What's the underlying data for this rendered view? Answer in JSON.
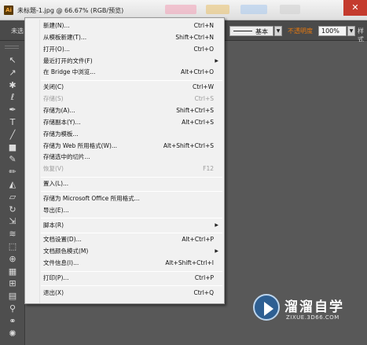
{
  "window": {
    "app_icon_text": "Ai",
    "title": "未标题-1.jpg @ 66.67% (RGB/预览)",
    "close_glyph": "✕"
  },
  "control_bar": {
    "left_label": "未选",
    "stroke_style": "基本",
    "opacity_label": "不透明度",
    "opacity_value": "100%",
    "style_label": "样式"
  },
  "tools": [
    {
      "name": "selection-tool",
      "glyph": "↖"
    },
    {
      "name": "direct-selection-tool",
      "glyph": "↗"
    },
    {
      "name": "magic-wand-tool",
      "glyph": "✱"
    },
    {
      "name": "lasso-tool",
      "glyph": "ℓ"
    },
    {
      "name": "pen-tool",
      "glyph": "✒"
    },
    {
      "name": "type-tool",
      "glyph": "T"
    },
    {
      "name": "line-tool",
      "glyph": "╱"
    },
    {
      "name": "rectangle-tool",
      "glyph": "■"
    },
    {
      "name": "paintbrush-tool",
      "glyph": "✎"
    },
    {
      "name": "pencil-tool",
      "glyph": "✏"
    },
    {
      "name": "blob-brush-tool",
      "glyph": "◭"
    },
    {
      "name": "eraser-tool",
      "glyph": "▱"
    },
    {
      "name": "rotate-tool",
      "glyph": "↻"
    },
    {
      "name": "scale-tool",
      "glyph": "⇲"
    },
    {
      "name": "warp-tool",
      "glyph": "≋"
    },
    {
      "name": "free-transform-tool",
      "glyph": "⬚"
    },
    {
      "name": "shape-builder-tool",
      "glyph": "⊕"
    },
    {
      "name": "perspective-grid-tool",
      "glyph": "▦"
    },
    {
      "name": "mesh-tool",
      "glyph": "⊞"
    },
    {
      "name": "gradient-tool",
      "glyph": "▤"
    },
    {
      "name": "eyedropper-tool",
      "glyph": "⚲"
    },
    {
      "name": "blend-tool",
      "glyph": "⚭"
    },
    {
      "name": "symbol-sprayer-tool",
      "glyph": "✺"
    }
  ],
  "file_menu": {
    "items": [
      {
        "type": "item",
        "label": "新建(N)...",
        "shortcut": "Ctrl+N",
        "enabled": true,
        "submenu": false
      },
      {
        "type": "item",
        "label": "从模板新建(T)...",
        "shortcut": "Shift+Ctrl+N",
        "enabled": true,
        "submenu": false
      },
      {
        "type": "item",
        "label": "打开(O)...",
        "shortcut": "Ctrl+O",
        "enabled": true,
        "submenu": false
      },
      {
        "type": "item",
        "label": "最近打开的文件(F)",
        "shortcut": "",
        "enabled": true,
        "submenu": true
      },
      {
        "type": "item",
        "label": "在 Bridge 中浏览...",
        "shortcut": "Alt+Ctrl+O",
        "enabled": true,
        "submenu": false
      },
      {
        "type": "separator"
      },
      {
        "type": "item",
        "label": "关闭(C)",
        "shortcut": "Ctrl+W",
        "enabled": true,
        "submenu": false
      },
      {
        "type": "item",
        "label": "存储(S)",
        "shortcut": "Ctrl+S",
        "enabled": false,
        "submenu": false
      },
      {
        "type": "item",
        "label": "存储为(A)...",
        "shortcut": "Shift+Ctrl+S",
        "enabled": true,
        "submenu": false
      },
      {
        "type": "item",
        "label": "存储副本(Y)...",
        "shortcut": "Alt+Ctrl+S",
        "enabled": true,
        "submenu": false
      },
      {
        "type": "item",
        "label": "存储为模板...",
        "shortcut": "",
        "enabled": true,
        "submenu": false
      },
      {
        "type": "item",
        "label": "存储为 Web 所用格式(W)...",
        "shortcut": "Alt+Shift+Ctrl+S",
        "enabled": true,
        "submenu": false
      },
      {
        "type": "item",
        "label": "存储选中的切片...",
        "shortcut": "",
        "enabled": true,
        "submenu": false
      },
      {
        "type": "item",
        "label": "恢复(V)",
        "shortcut": "F12",
        "enabled": false,
        "submenu": false
      },
      {
        "type": "separator"
      },
      {
        "type": "item",
        "label": "置入(L)...",
        "shortcut": "",
        "enabled": true,
        "submenu": false
      },
      {
        "type": "separator"
      },
      {
        "type": "item",
        "label": "存储为 Microsoft Office 所用格式...",
        "shortcut": "",
        "enabled": true,
        "submenu": false
      },
      {
        "type": "item",
        "label": "导出(E)...",
        "shortcut": "",
        "enabled": true,
        "submenu": false
      },
      {
        "type": "separator"
      },
      {
        "type": "item",
        "label": "脚本(R)",
        "shortcut": "",
        "enabled": true,
        "submenu": true
      },
      {
        "type": "separator"
      },
      {
        "type": "item",
        "label": "文档设置(D)...",
        "shortcut": "Alt+Ctrl+P",
        "enabled": true,
        "submenu": false
      },
      {
        "type": "item",
        "label": "文档颜色模式(M)",
        "shortcut": "",
        "enabled": true,
        "submenu": true
      },
      {
        "type": "item",
        "label": "文件信息(I)...",
        "shortcut": "Alt+Shift+Ctrl+I",
        "enabled": true,
        "submenu": false
      },
      {
        "type": "separator"
      },
      {
        "type": "item",
        "label": "打印(P)...",
        "shortcut": "Ctrl+P",
        "enabled": true,
        "submenu": false
      },
      {
        "type": "separator"
      },
      {
        "type": "item",
        "label": "退出(X)",
        "shortcut": "Ctrl+Q",
        "enabled": true,
        "submenu": false
      }
    ]
  },
  "watermark": {
    "cn_text": "溜溜自学",
    "url_text": "ZIXUE.3D66.COM"
  },
  "colors": {
    "accent_orange": "#e5780f",
    "workspace": "#585858",
    "panel": "#4e4e4e",
    "menu_bg": "#f1f1f1",
    "close_red": "#c43b2e"
  }
}
